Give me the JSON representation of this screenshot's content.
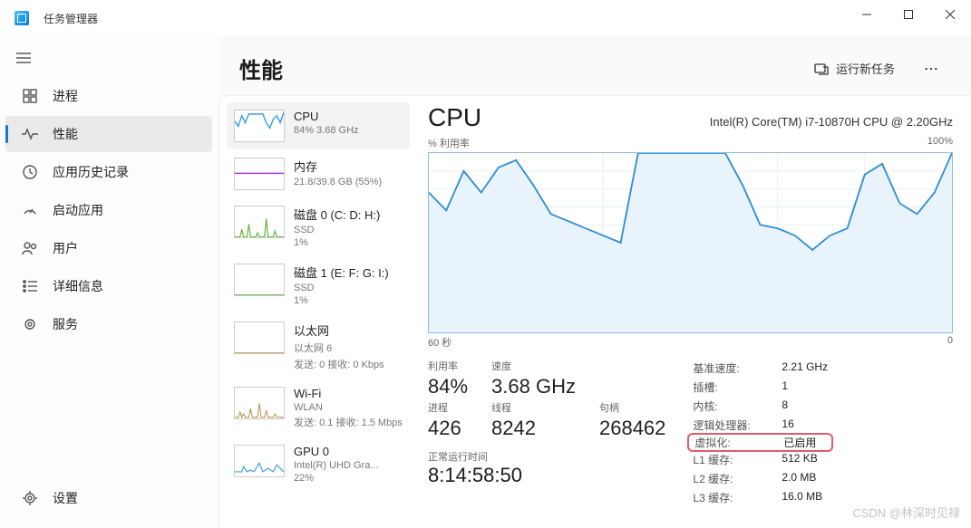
{
  "window": {
    "title": "任务管理器"
  },
  "nav": {
    "items": [
      {
        "label": "进程"
      },
      {
        "label": "性能"
      },
      {
        "label": "应用历史记录"
      },
      {
        "label": "启动应用"
      },
      {
        "label": "用户"
      },
      {
        "label": "详细信息"
      },
      {
        "label": "服务"
      }
    ],
    "settings_label": "设置"
  },
  "header": {
    "title": "性能",
    "run_task": "运行新任务"
  },
  "resources": [
    {
      "title": "CPU",
      "sub": "84% 3.68 GHz",
      "color": "#3b9fe0"
    },
    {
      "title": "内存",
      "sub": "21.8/39.8 GB (55%)",
      "color": "#a23bd8"
    },
    {
      "title": "磁盘 0 (C: D: H:)",
      "sub": "SSD",
      "sub2": "1%",
      "color": "#5fb53a"
    },
    {
      "title": "磁盘 1 (E: F: G: I:)",
      "sub": "SSD",
      "sub2": "1%",
      "color": "#5fb53a"
    },
    {
      "title": "以太网",
      "sub": "以太网 6",
      "sub2": "发送: 0 接收: 0 Kbps",
      "color": "#b78a46"
    },
    {
      "title": "Wi-Fi",
      "sub": "WLAN",
      "sub2": "发送: 0.1 接收: 1.5 Mbps",
      "color": "#b78a46"
    },
    {
      "title": "GPU 0",
      "sub": "Intel(R) UHD Gra...",
      "sub2": "22%",
      "color": "#3b9fe0"
    }
  ],
  "detail": {
    "heading": "CPU",
    "cpu_name": "Intel(R) Core(TM) i7-10870H CPU @ 2.20GHz",
    "chart_top_left": "% 利用率",
    "chart_top_right": "100%",
    "axis_left": "60 秒",
    "axis_right": "0",
    "stats": {
      "util_label": "利用率",
      "util_val": "84%",
      "speed_label": "速度",
      "speed_val": "3.68 GHz",
      "proc_label": "进程",
      "proc_val": "426",
      "threads_label": "线程",
      "threads_val": "8242",
      "handles_label": "句柄",
      "handles_val": "268462",
      "uptime_label": "正常运行时间",
      "uptime_val": "8:14:58:50"
    },
    "info": [
      {
        "k": "基准速度:",
        "v": "2.21 GHz"
      },
      {
        "k": "插槽:",
        "v": "1"
      },
      {
        "k": "内核:",
        "v": "8"
      },
      {
        "k": "逻辑处理器:",
        "v": "16"
      },
      {
        "k": "虚拟化:",
        "v": "已启用",
        "highlight": true
      },
      {
        "k": "L1 缓存:",
        "v": "512 KB"
      },
      {
        "k": "L2 缓存:",
        "v": "2.0 MB"
      },
      {
        "k": "L3 缓存:",
        "v": "16.0 MB"
      }
    ]
  },
  "watermark": "CSDN @林深时见禄",
  "chart_data": {
    "type": "line",
    "title": "% 利用率",
    "xlabel": "60 秒 → 0",
    "ylabel": "% 利用率",
    "ylim": [
      0,
      100
    ],
    "x_seconds": [
      60,
      58,
      56,
      54,
      52,
      50,
      48,
      46,
      44,
      42,
      40,
      38,
      36,
      34,
      32,
      30,
      28,
      26,
      24,
      22,
      20,
      18,
      16,
      14,
      12,
      10,
      8,
      6,
      4,
      2,
      0
    ],
    "values": [
      78,
      68,
      90,
      78,
      92,
      96,
      82,
      66,
      62,
      58,
      54,
      50,
      100,
      100,
      100,
      100,
      100,
      100,
      82,
      60,
      58,
      54,
      46,
      54,
      58,
      88,
      94,
      72,
      66,
      78,
      100
    ]
  }
}
